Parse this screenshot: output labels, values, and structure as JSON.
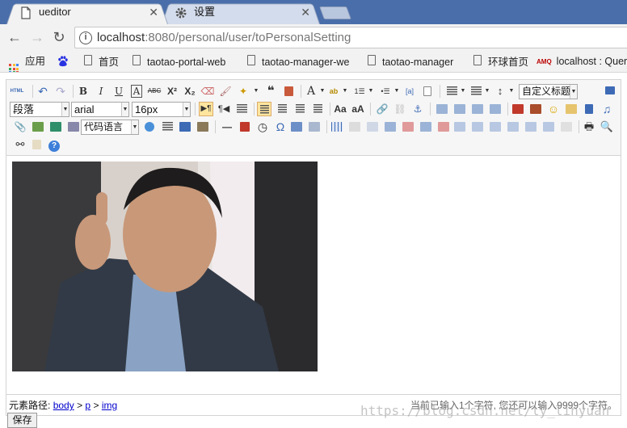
{
  "browser": {
    "tabs": [
      {
        "title": "ueditor",
        "active": true
      },
      {
        "title": "设置",
        "active": false
      }
    ],
    "url": {
      "host": "localhost",
      "rest": ":8080/personal/user/toPersonalSetting"
    },
    "bookmarks": [
      {
        "label": "应用",
        "icon": "apps-grid-icon"
      },
      {
        "label": "",
        "icon": "baidu-paw-icon"
      },
      {
        "label": "首页",
        "icon": "page-icon"
      },
      {
        "label": "taotao-portal-web",
        "icon": "page-icon"
      },
      {
        "label": "taotao-manager-we",
        "icon": "page-icon"
      },
      {
        "label": "taotao-manager",
        "icon": "page-icon"
      },
      {
        "label": "环球首页",
        "icon": "page-icon"
      },
      {
        "label": "localhost : Quer",
        "icon": "amq-icon"
      }
    ]
  },
  "editor": {
    "toolbar": {
      "paragraph": "段落",
      "font_family": "arial",
      "font_size": "16px",
      "custom_title": "自定义标题",
      "code_language": "代码语言",
      "html_label": "HTML",
      "ui_colors": {
        "highlight": "#ffe69f",
        "border": "#d4d4d4",
        "link": "#0000cc"
      }
    },
    "status": {
      "path_label": "元素路径:",
      "path": [
        "body",
        "p",
        "img"
      ],
      "separator": ">",
      "word_count": "当前已输入1个字符, 您还可以输入9999个字符。"
    }
  },
  "save_button": "保存",
  "watermark": "https://blog.csdn.net/ly_linyuan"
}
